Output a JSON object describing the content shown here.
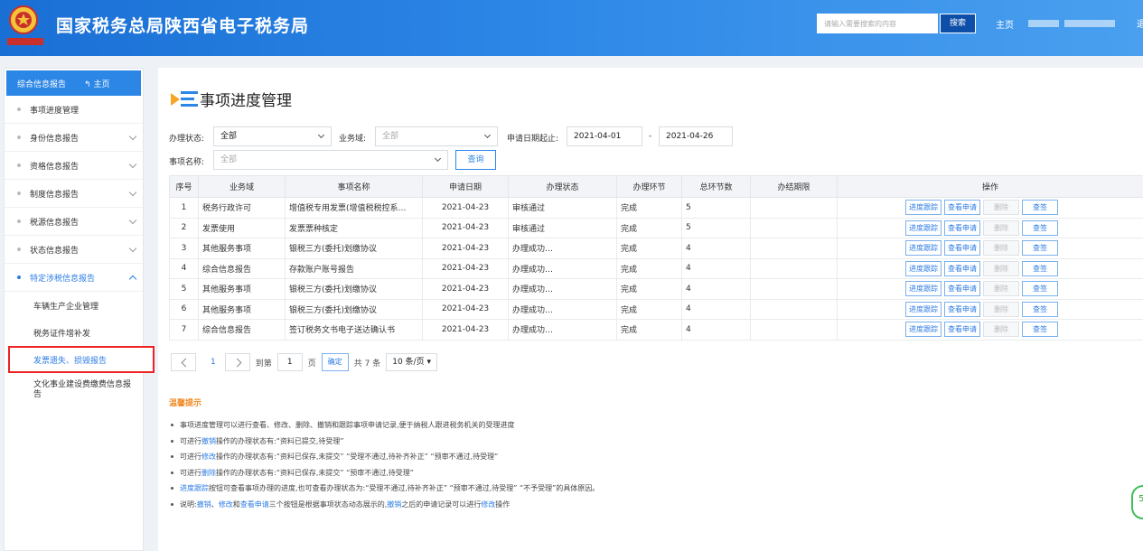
{
  "header": {
    "site_title": "国家税务总局陕西省电子税务局",
    "search_placeholder": "请输入需要搜索的内容",
    "search_label": "搜索",
    "home_label": "主页",
    "tail_text": "退"
  },
  "sidebar": {
    "top_label": "综合信息报告",
    "top_home": "主页",
    "items": [
      {
        "label": "事项进度管理"
      },
      {
        "label": "身份信息报告"
      },
      {
        "label": "资格信息报告"
      },
      {
        "label": "制度信息报告"
      },
      {
        "label": "税源信息报告"
      },
      {
        "label": "状态信息报告"
      },
      {
        "label": "特定涉税信息报告"
      }
    ],
    "sub_items": [
      {
        "label": "车辆生产企业管理"
      },
      {
        "label": "税务证件增补发"
      },
      {
        "label": "发票遗失、损毁报告"
      },
      {
        "label": "文化事业建设费缴费信息报告"
      }
    ]
  },
  "main": {
    "page_title": "事项进度管理",
    "filters": {
      "status_label": "办理状态:",
      "status_value": "全部",
      "domain_label": "业务域:",
      "domain_value": "全部",
      "date_label": "申请日期起止:",
      "date_start": "2021-04-01",
      "date_sep": "-",
      "date_end": "2021-04-26",
      "name_label": "事项名称:",
      "name_value": "全部",
      "query_label": "查询"
    },
    "table": {
      "headers": [
        "序号",
        "业务域",
        "事项名称",
        "申请日期",
        "办理状态",
        "办理环节",
        "总环节数",
        "办结期限",
        "操作"
      ],
      "rows": [
        {
          "no": "1",
          "domain": "税务行政许可",
          "name": "增值税专用发票(增值税税控系…",
          "date": "2021-04-23",
          "status": "审核通过",
          "stage": "完成",
          "total": "5",
          "deadline": ""
        },
        {
          "no": "2",
          "domain": "发票使用",
          "name": "发票票种核定",
          "date": "2021-04-23",
          "status": "审核通过",
          "stage": "完成",
          "total": "5",
          "deadline": ""
        },
        {
          "no": "3",
          "domain": "其他服务事项",
          "name": "银税三方(委托)划缴协议",
          "date": "2021-04-23",
          "status": "办理成功…",
          "stage": "完成",
          "total": "4",
          "deadline": ""
        },
        {
          "no": "4",
          "domain": "综合信息报告",
          "name": "存款账户账号报告",
          "date": "2021-04-23",
          "status": "办理成功…",
          "stage": "完成",
          "total": "4",
          "deadline": ""
        },
        {
          "no": "5",
          "domain": "其他服务事项",
          "name": "银税三方(委托)划缴协议",
          "date": "2021-04-23",
          "status": "办理成功…",
          "stage": "完成",
          "total": "4",
          "deadline": ""
        },
        {
          "no": "6",
          "domain": "其他服务事项",
          "name": "银税三方(委托)划缴协议",
          "date": "2021-04-23",
          "status": "办理成功…",
          "stage": "完成",
          "total": "4",
          "deadline": ""
        },
        {
          "no": "7",
          "domain": "综合信息报告",
          "name": "签订税务文书电子送达确认书",
          "date": "2021-04-23",
          "status": "办理成功…",
          "stage": "完成",
          "total": "4",
          "deadline": ""
        }
      ],
      "actions": [
        "进度跟踪",
        "查看申请",
        "删除",
        "查签"
      ]
    },
    "pager": {
      "current": "1",
      "goto_label": "到第",
      "page_input": "1",
      "page_unit": "页",
      "confirm_label": "确定",
      "total_text": "共 7 条",
      "page_size": "10 条/页"
    },
    "tips": {
      "title": "温馨提示",
      "t1": "事项进度管理可以进行查看、修改、删除、撤销和跟踪事项申请记录,便于纳税人跟进税务机关的受理进度",
      "t2_pre": "可进行",
      "t2_hl": "撤销",
      "t2_post": "操作的办理状态有:“资料已提交,待受理”",
      "t3_pre": "可进行",
      "t3_hl": "修改",
      "t3_post": "操作的办理状态有:“资料已保存,未提交” “受理不通过,待补齐补正” “预审不通过,待受理”",
      "t4_pre": "可进行",
      "t4_hl": "删除",
      "t4_post": "操作的办理状态有:“资料已保存,未提交” “预审不通过,待受理”",
      "t5_hl": "进度跟踪",
      "t5_post": "按钮可查看事项办理的进度,也可查看办理状态为:“受理不通过,待补齐补正” “预审不通过,待受理” “不予受理”的具体原因。",
      "t6_pre": "说明:",
      "t6_hl1": "撤销",
      "t6_sep": "、",
      "t6_hl2": "修改",
      "t6_and": "和",
      "t6_hl3": "查看申请",
      "t6_mid": "三个按钮是根据事项状态动态展示的,",
      "t6_hl4": "撤销",
      "t6_mid2": "之后的申请记录可以进行",
      "t6_hl5": "修改",
      "t6_end": "操作"
    },
    "float_badge": "5"
  }
}
